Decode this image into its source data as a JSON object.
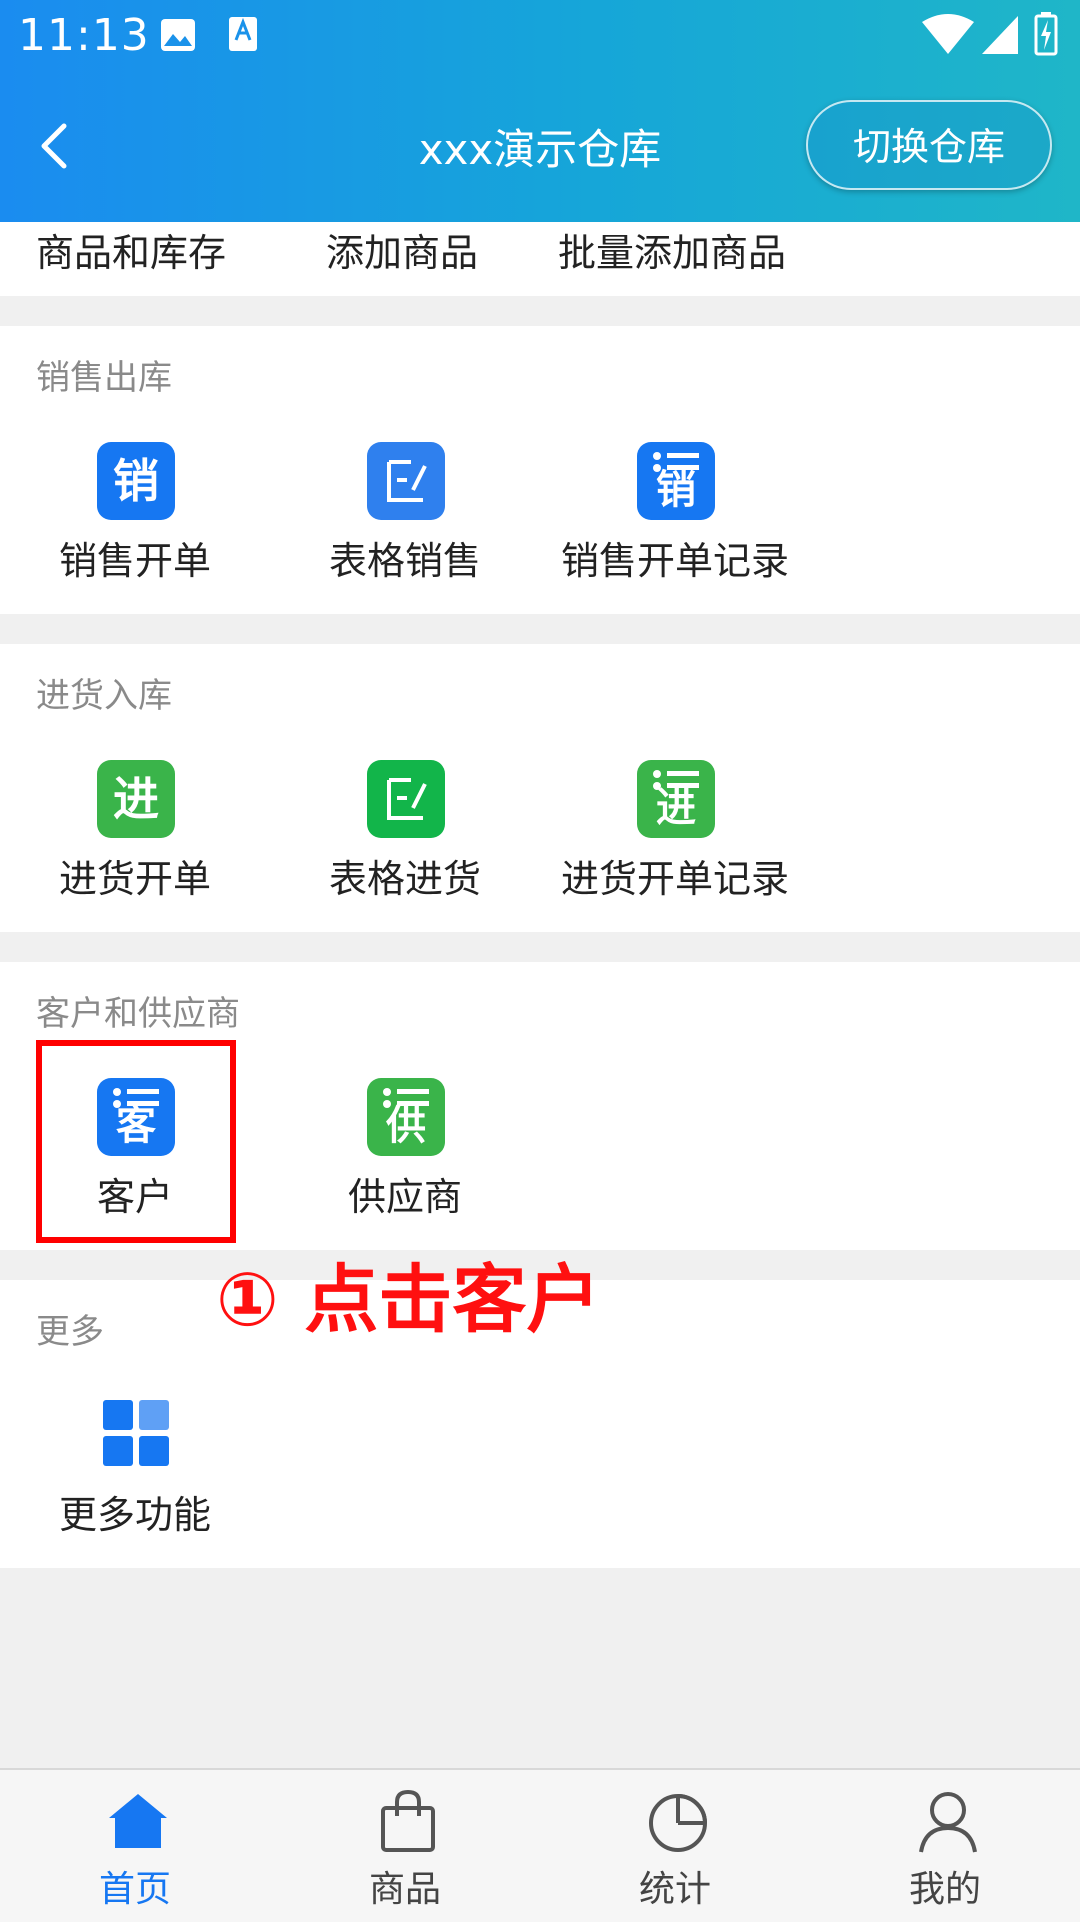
{
  "status_bar": {
    "time": "11:13"
  },
  "header": {
    "title": "xxx演示仓库",
    "switch_label": "切换仓库"
  },
  "top_row": {
    "items": [
      "商品和库存",
      "添加商品",
      "批量添加商品"
    ]
  },
  "sections": [
    {
      "title": "销售出库",
      "items": [
        {
          "label": "销售开单",
          "icon_text": "销"
        },
        {
          "label": "表格销售",
          "icon_text": ""
        },
        {
          "label": "销售开单记录",
          "icon_text": "销"
        }
      ]
    },
    {
      "title": "进货入库",
      "items": [
        {
          "label": "进货开单",
          "icon_text": "进"
        },
        {
          "label": "表格进货",
          "icon_text": ""
        },
        {
          "label": "进货开单记录",
          "icon_text": "进"
        }
      ]
    },
    {
      "title": "客户和供应商",
      "items": [
        {
          "label": "客户",
          "icon_text": "客"
        },
        {
          "label": "供应商",
          "icon_text": "供"
        }
      ]
    },
    {
      "title": "更多",
      "items": [
        {
          "label": "更多功能"
        }
      ]
    }
  ],
  "annotation": "① 点击客户",
  "bottom_nav": [
    {
      "label": "首页",
      "icon": "home-icon"
    },
    {
      "label": "商品",
      "icon": "bag-icon"
    },
    {
      "label": "统计",
      "icon": "pie-chart-icon"
    },
    {
      "label": "我的",
      "icon": "person-icon"
    }
  ],
  "colors": {
    "accent": "#1677f2",
    "green": "#3ab44a",
    "header_start": "#1a8cf0",
    "header_end": "#1fb6c8",
    "annotation": "#ff1010"
  }
}
